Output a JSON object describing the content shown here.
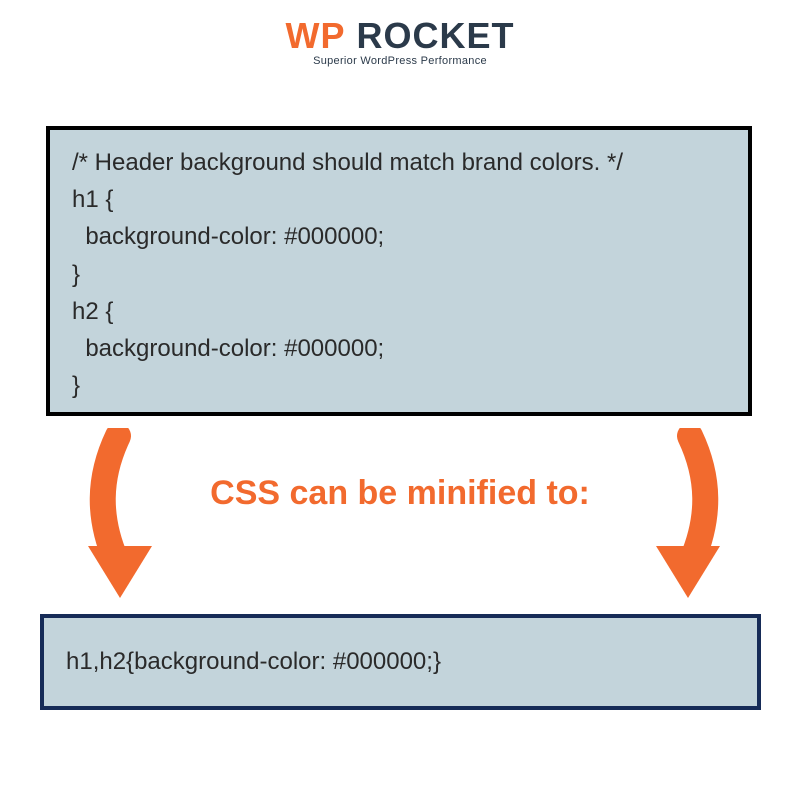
{
  "logo": {
    "wp": "WP",
    "rocket": " ROCKET",
    "tagline": "Superior WordPress Performance"
  },
  "code_before": "/* Header background should match brand colors. */\nh1 {\n  background-color: #000000;\n}\nh2 {\n  background-color: #000000;\n}",
  "caption": "CSS can be minified to:",
  "code_after": "h1,h2{background-color: #000000;}",
  "colors": {
    "accent": "#f26a2e",
    "panel_bg": "#c3d4db",
    "panel_border_dark": "#000000",
    "panel_border_navy": "#162b57",
    "text": "#2a2a2a"
  }
}
